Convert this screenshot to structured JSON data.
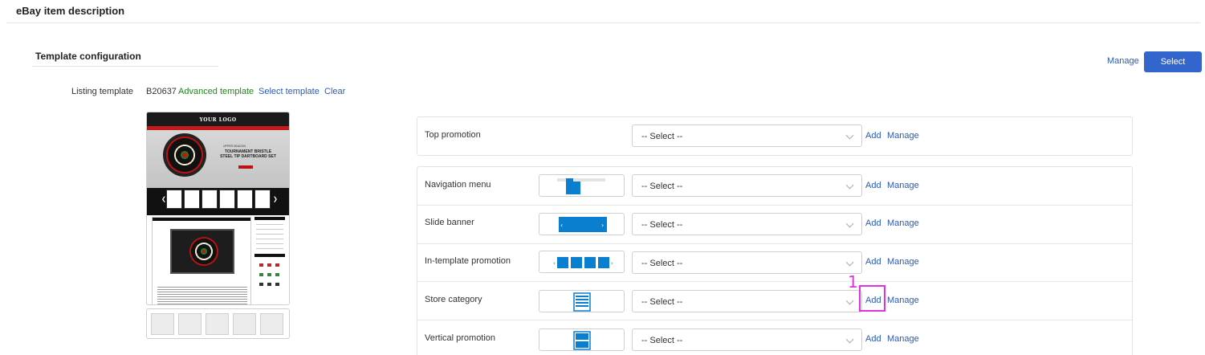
{
  "page": {
    "title": "eBay item description"
  },
  "section": {
    "title": "Template configuration"
  },
  "top_actions": {
    "manage_label": "Manage",
    "select_label": "Select"
  },
  "listing": {
    "label": "Listing template",
    "code": "B20637",
    "type": "Advanced template",
    "select_link": "Select template",
    "clear_link": "Clear"
  },
  "preview": {
    "logo_text": "YOUR LOGO",
    "tagline": "UPPER DEADON",
    "headline_1": "TOURNAMENT BRISTLE",
    "headline_2": "STEEL TIP DARTBOARD SET"
  },
  "rows": [
    {
      "label": "Top promotion",
      "select": "-- Select --",
      "add": "Add",
      "manage": "Manage",
      "icon": "none"
    },
    {
      "label": "Navigation menu",
      "select": "-- Select --",
      "add": "Add",
      "manage": "Manage",
      "icon": "navigation-menu-icon"
    },
    {
      "label": "Slide banner",
      "select": "-- Select --",
      "add": "Add",
      "manage": "Manage",
      "icon": "slide-banner-icon"
    },
    {
      "label": "In-template promotion",
      "select": "-- Select --",
      "add": "Add",
      "manage": "Manage",
      "icon": "in-template-promotion-icon"
    },
    {
      "label": "Store category",
      "select": "-- Select --",
      "add": "Add",
      "manage": "Manage",
      "icon": "store-category-icon"
    },
    {
      "label": "Vertical promotion",
      "select": "-- Select --",
      "add": "Add",
      "manage": "Manage",
      "icon": "vertical-promotion-icon"
    }
  ],
  "annotation": {
    "marker": "1"
  },
  "colors": {
    "accent": "#3366cc",
    "link": "#2a5ab8",
    "green": "#1c8a1c",
    "icon_blue": "#0a7fd0",
    "highlight": "#e033e0"
  }
}
